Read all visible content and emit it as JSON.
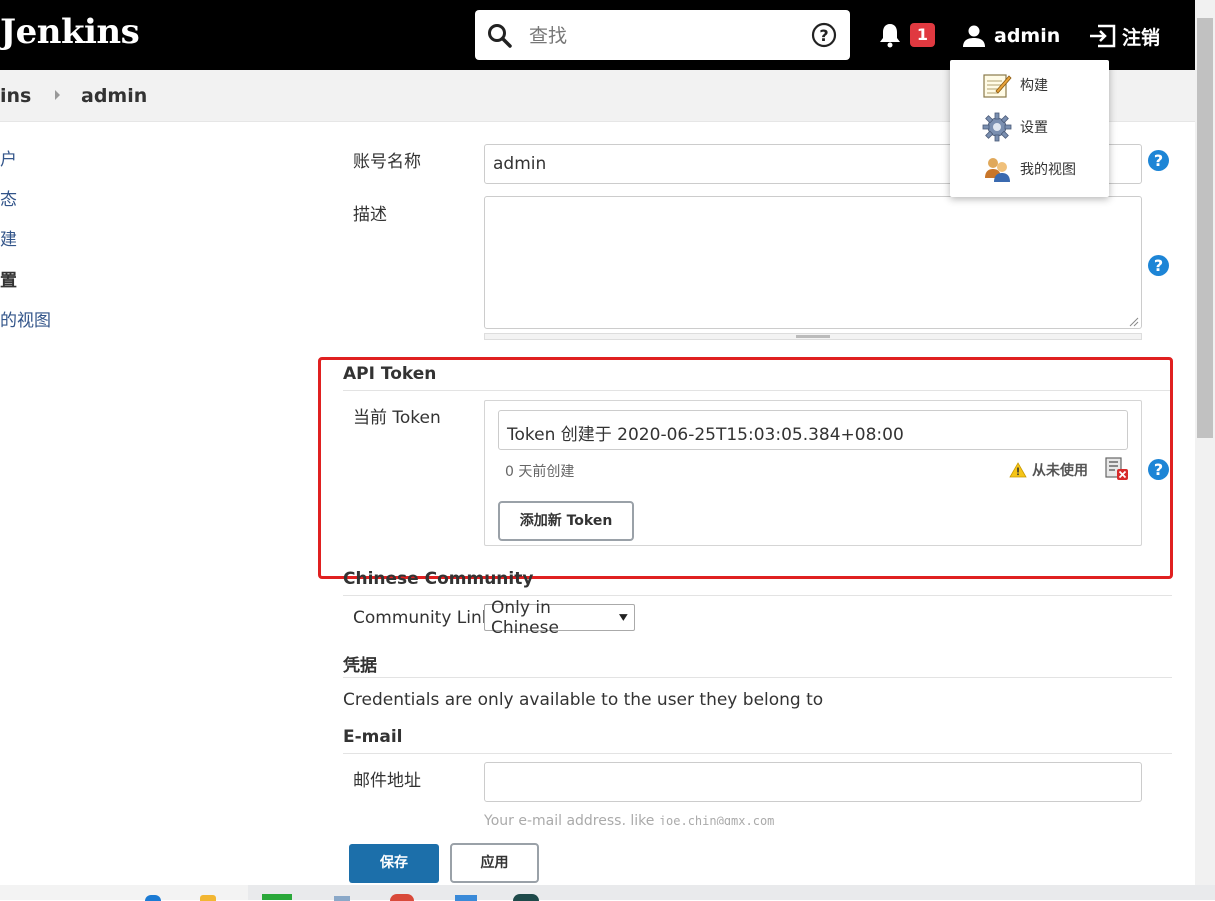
{
  "header": {
    "logo": "Jenkins",
    "search_placeholder": "查找",
    "notification_count": "1",
    "user": "admin",
    "logout": "注销"
  },
  "user_menu": {
    "items": [
      {
        "label": "构建",
        "icon": "notepad-icon"
      },
      {
        "label": "设置",
        "icon": "gear-icon"
      },
      {
        "label": "我的视图",
        "icon": "users-icon"
      }
    ]
  },
  "breadcrumb": {
    "root": "ins",
    "current": "admin"
  },
  "sidebar": {
    "items": [
      {
        "label": "户",
        "active": false
      },
      {
        "label": "态",
        "active": false
      },
      {
        "label": "建",
        "active": false
      },
      {
        "label": "置",
        "active": true
      },
      {
        "label": "的视图",
        "active": false
      }
    ]
  },
  "form": {
    "account_label": "账号名称",
    "account_value": "admin",
    "description_label": "描述",
    "api_token_title": "API Token",
    "current_token_label": "当前 Token",
    "token_name_value": "Token 创建于 2020-06-25T15:03:05.384+08:00",
    "token_created": "0 天前创建",
    "token_unused": "从未使用",
    "add_token_button": "添加新 Token",
    "community_title": "Chinese Community",
    "community_link_label": "Community Link",
    "community_link_value": "Only in Chinese",
    "credentials_title": "凭据",
    "credentials_text": "Credentials are only available to the user they belong to",
    "email_title": "E-mail",
    "email_label": "邮件地址",
    "email_value": "",
    "email_hint": "Your e-mail address, like",
    "email_hint_example": "joe.chin@gmx.com",
    "save_button": "保存",
    "apply_button": "应用"
  },
  "colors": {
    "header_bg": "#000000",
    "badge": "#e03940",
    "help": "#1d85d6",
    "primary_button": "#1c6faa",
    "highlight_frame": "#e02020"
  }
}
